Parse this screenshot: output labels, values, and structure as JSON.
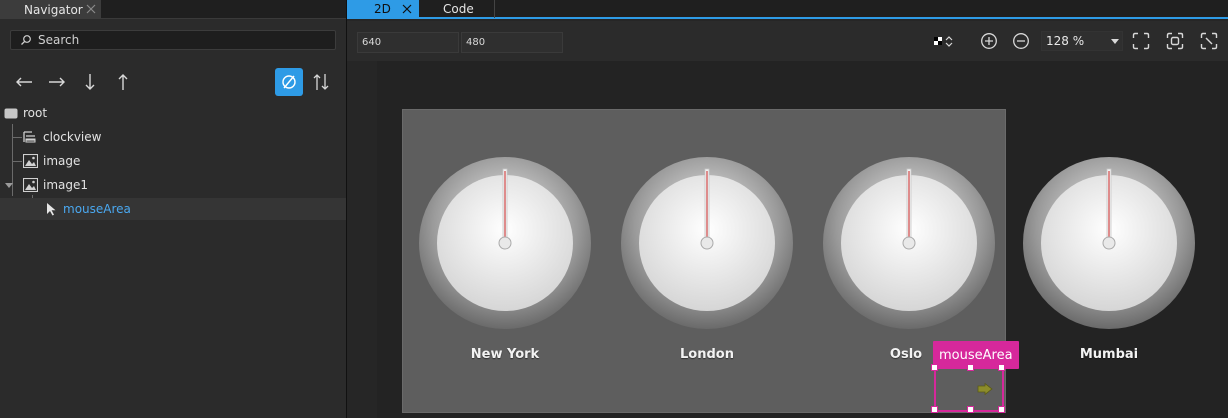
{
  "navigator": {
    "tab_label": "Navigator",
    "search_placeholder": "Search",
    "tools": [
      "arrow-left-icon",
      "arrow-right-icon",
      "arrow-down-icon",
      "arrow-up-icon",
      "filter-icon",
      "sort-icon"
    ],
    "tree": [
      {
        "label": "root",
        "icon": "root-rect-icon"
      },
      {
        "label": "clockview",
        "icon": "listview-icon"
      },
      {
        "label": "image",
        "icon": "image-icon"
      },
      {
        "label": "image1",
        "icon": "image-icon",
        "expanded": true
      },
      {
        "label": "mouseArea",
        "icon": "pointer-icon",
        "selected": true
      }
    ]
  },
  "editor": {
    "tabs": [
      {
        "label": "2D",
        "active": true
      },
      {
        "label": "Code",
        "active": false
      }
    ],
    "toolbar": {
      "width_value": "640",
      "height_value": "480",
      "zoom_value": "128 %"
    },
    "canvas": {
      "clocks": [
        {
          "city": "New York"
        },
        {
          "city": "London"
        },
        {
          "city": "Oslo"
        },
        {
          "city": "Mumbai"
        }
      ],
      "selection_label": "mouseArea"
    }
  },
  "colors": {
    "accent": "#2e9be6",
    "selection": "#d6289b",
    "selected_text": "#4aa8f0",
    "form_bg": "#5e5e5e"
  }
}
